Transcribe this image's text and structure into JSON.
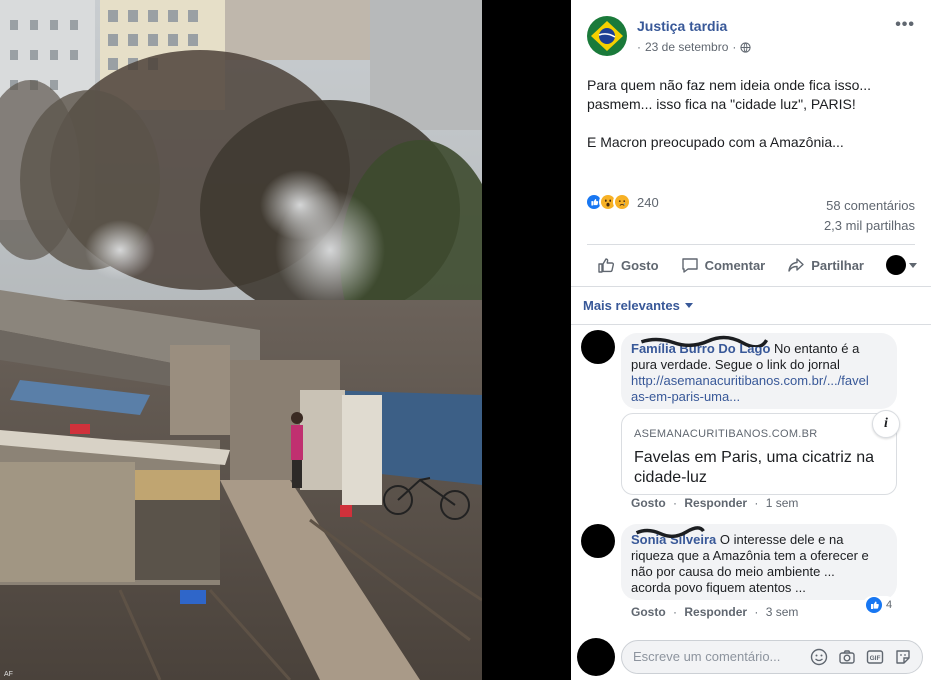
{
  "photo": {
    "description_icon": "shantytown-photo",
    "watermark": "AF"
  },
  "post": {
    "author": "Justiça tardia",
    "date": "23 de setembro",
    "separator": "·",
    "privacy_icon": "globe-icon",
    "more_icon": "more-options-icon",
    "more_label": "•••",
    "text_lines": [
      "Para quem não faz nem ideia onde fica isso...",
      "pasmem... isso fica na \"cidade luz\", PARIS!",
      "E Macron preocupado com a Amazônia..."
    ]
  },
  "reactions": {
    "icons": [
      "like-icon",
      "wow-icon",
      "sad-icon"
    ],
    "count": "240",
    "comments": "58 comentários",
    "shares": "2,3 mil partilhas"
  },
  "actions": {
    "like": "Gosto",
    "comment": "Comentar",
    "share": "Partilhar"
  },
  "comments_filter": "Mais relevantes",
  "comments": [
    {
      "author": "Família Burro Do Lago",
      "text": "No entanto é a pura verdade. Segue o link do jornal",
      "link": "http://asemanacuritibanos.com.br/.../favelas-em-paris-uma...",
      "link_line1": "http://asemanacuritibanos.com.br/.../favel",
      "link_line2": "as-em-paris-uma...",
      "preview": {
        "domain": "ASEMANACURITIBANOS.COM.BR",
        "title": "Favelas em Paris, uma cicatriz na cidade-luz",
        "info_label": "i"
      },
      "like": "Gosto",
      "reply": "Responder",
      "time": "1 sem"
    },
    {
      "author": "Sonia Silveira",
      "text_lines": [
        "O interesse dele e na",
        "riqueza que a Amazônia tem a oferecer e",
        "não por causa do meio ambiente ...",
        "acorda povo fiquem atentos ..."
      ],
      "like": "Gosto",
      "reply": "Responder",
      "time": "3 sem",
      "likes": "4"
    }
  ],
  "composer": {
    "placeholder": "Escreve um comentário...",
    "icons": [
      "emoji-icon",
      "camera-icon",
      "gif-icon",
      "sticker-icon"
    ],
    "gif_label": "GIF"
  },
  "colors": {
    "link": "#385898",
    "secondary": "#606770",
    "bubble": "#f2f3f5",
    "like_blue": "#1877f2",
    "reaction_yellow": "#f7b125"
  }
}
